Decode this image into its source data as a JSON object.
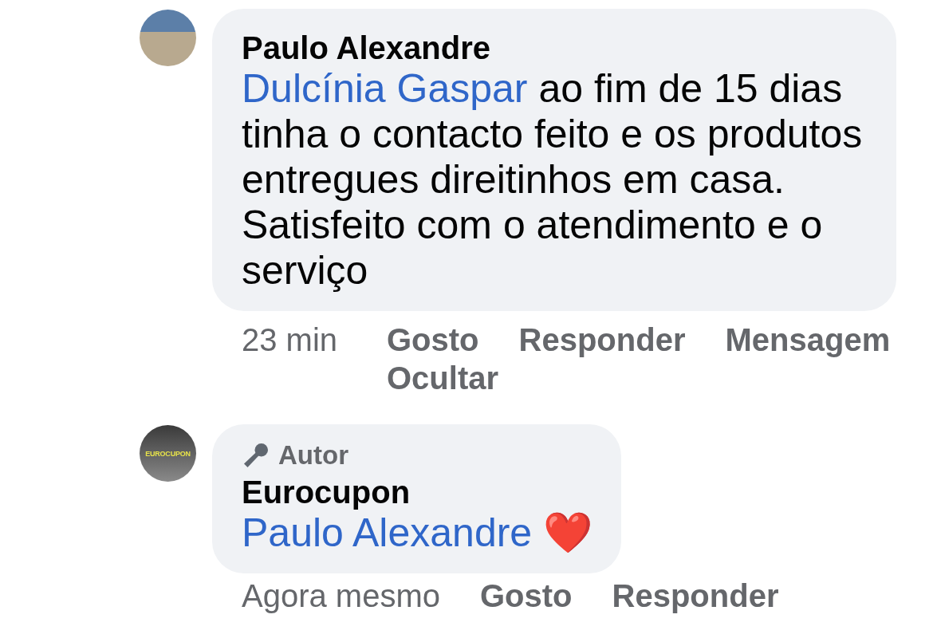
{
  "comments": [
    {
      "author": "Paulo Alexandre",
      "kind": "photo",
      "mention": "Dulcínia Gaspar",
      "text": " ao fim de 15 dias tinha o contacto feito e os produtos entregues direitinhos em casa. Satisfeito com o atendimento e o serviço",
      "time": "23 min",
      "actions": [
        "Gosto",
        "Responder",
        "Mensagem",
        "Ocultar"
      ]
    },
    {
      "author": "Eurocupon",
      "kind": "logo",
      "logo_text": "EUROCUPON",
      "author_badge": "Autor",
      "mention": "Paulo Alexandre",
      "text": " ❤️",
      "time": "Agora mesmo",
      "actions": [
        "Gosto",
        "Responder"
      ]
    }
  ]
}
